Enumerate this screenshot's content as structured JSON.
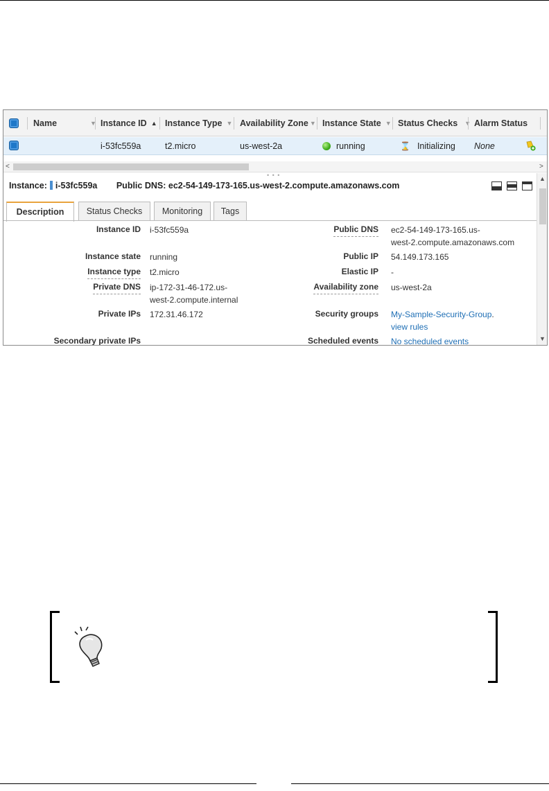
{
  "grid": {
    "columns": [
      {
        "label": "Name",
        "caret": "▼"
      },
      {
        "label": "Instance ID",
        "caret": "▲"
      },
      {
        "label": "Instance Type",
        "caret": "▼"
      },
      {
        "label": "Availability Zone",
        "caret": "▼"
      },
      {
        "label": "Instance State",
        "caret": "▼"
      },
      {
        "label": "Status Checks",
        "caret": "▼"
      },
      {
        "label": "Alarm Status",
        "caret": ""
      }
    ],
    "row": {
      "instance_id": "i-53fc559a",
      "instance_type": "t2.micro",
      "availability_zone": "us-west-2a",
      "instance_state": "running",
      "status_checks": "Initializing",
      "alarm_status": "None"
    }
  },
  "detail": {
    "instance_label": "Instance:",
    "instance_id": "i-53fc559a",
    "dns_label": "Public DNS:",
    "dns_value": "ec2-54-149-173-165.us-west-2.compute.amazonaws.com"
  },
  "tabs": [
    "Description",
    "Status Checks",
    "Monitoring",
    "Tags"
  ],
  "description": {
    "left": [
      {
        "label": "Instance ID",
        "value": "i-53fc559a"
      },
      {
        "label": "Instance state",
        "value": "running"
      },
      {
        "label": "Instance type",
        "value": "t2.micro"
      },
      {
        "label": "Private DNS",
        "value": "ip-172-31-46-172.us-",
        "value2": "west-2.compute.internal"
      },
      {
        "label": "Private IPs",
        "value": "172.31.46.172"
      },
      {
        "label": "Secondary private IPs",
        "value": ""
      }
    ],
    "right": [
      {
        "label": "Public DNS",
        "value": "ec2-54-149-173-165.us-",
        "value2": "west-2.compute.amazonaws.com"
      },
      {
        "label": "Public IP",
        "value": "54.149.173.165"
      },
      {
        "label": "Elastic IP",
        "value": "-"
      },
      {
        "label": "Availability zone",
        "value": "us-west-2a"
      },
      {
        "label": "Security groups",
        "value": "My-Sample-Security-Group",
        "value_suffix": ".",
        "value2": "view rules"
      },
      {
        "label": "Scheduled events",
        "value": "No scheduled events"
      }
    ]
  },
  "colors": {
    "accent_blue": "#1f78c8",
    "link_blue": "#1f6fb5",
    "running_green": "#3fae1c",
    "active_tab_orange": "#e8a33d"
  },
  "icons": {
    "status_dot": "green-dot-icon",
    "status_checks": "hourglass-icon",
    "alarm": "alarm-add-icon",
    "tip": "lightbulb-icon"
  }
}
